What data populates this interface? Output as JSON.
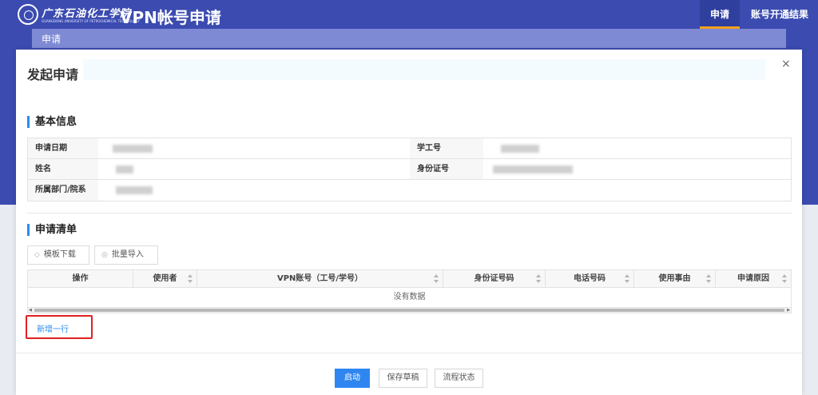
{
  "header": {
    "school_name": "广东石油化工学院",
    "school_name_en": "GUANGDONG UNIVERSITY OF PETROCHEMICAL TECHNOLOGY",
    "app_title": "VPN帐号申请",
    "nav": [
      {
        "label": "申请",
        "active": true
      },
      {
        "label": "账号开通结果",
        "active": false
      }
    ]
  },
  "page": {
    "sub_label": "申请"
  },
  "modal": {
    "title": "发起申请",
    "close": "×",
    "basic_section": "基本信息",
    "basic_fields": {
      "apply_date": "申请日期",
      "staff_no": "学工号",
      "name": "姓名",
      "id_no": "身份证号",
      "department": "所属部门/院系"
    },
    "list_section": "申请清单",
    "buttons": {
      "template_download": "模板下载",
      "batch_import": "批量导入"
    },
    "table": {
      "columns": [
        "操作",
        "使用者",
        "VPN账号（工号/学号）",
        "身份证号码",
        "电话号码",
        "使用事由",
        "申请原因"
      ],
      "empty_text": "没有数据"
    },
    "add_row": "新增一行",
    "footer": {
      "start": "启动",
      "save_draft": "保存草稿",
      "flow_status": "流程状态"
    }
  },
  "colors": {
    "header_bg": "#3b4bb0",
    "accent_blue": "#2f86f0",
    "active_tab_underline": "#f0a020",
    "highlight_box": "#e02020"
  }
}
